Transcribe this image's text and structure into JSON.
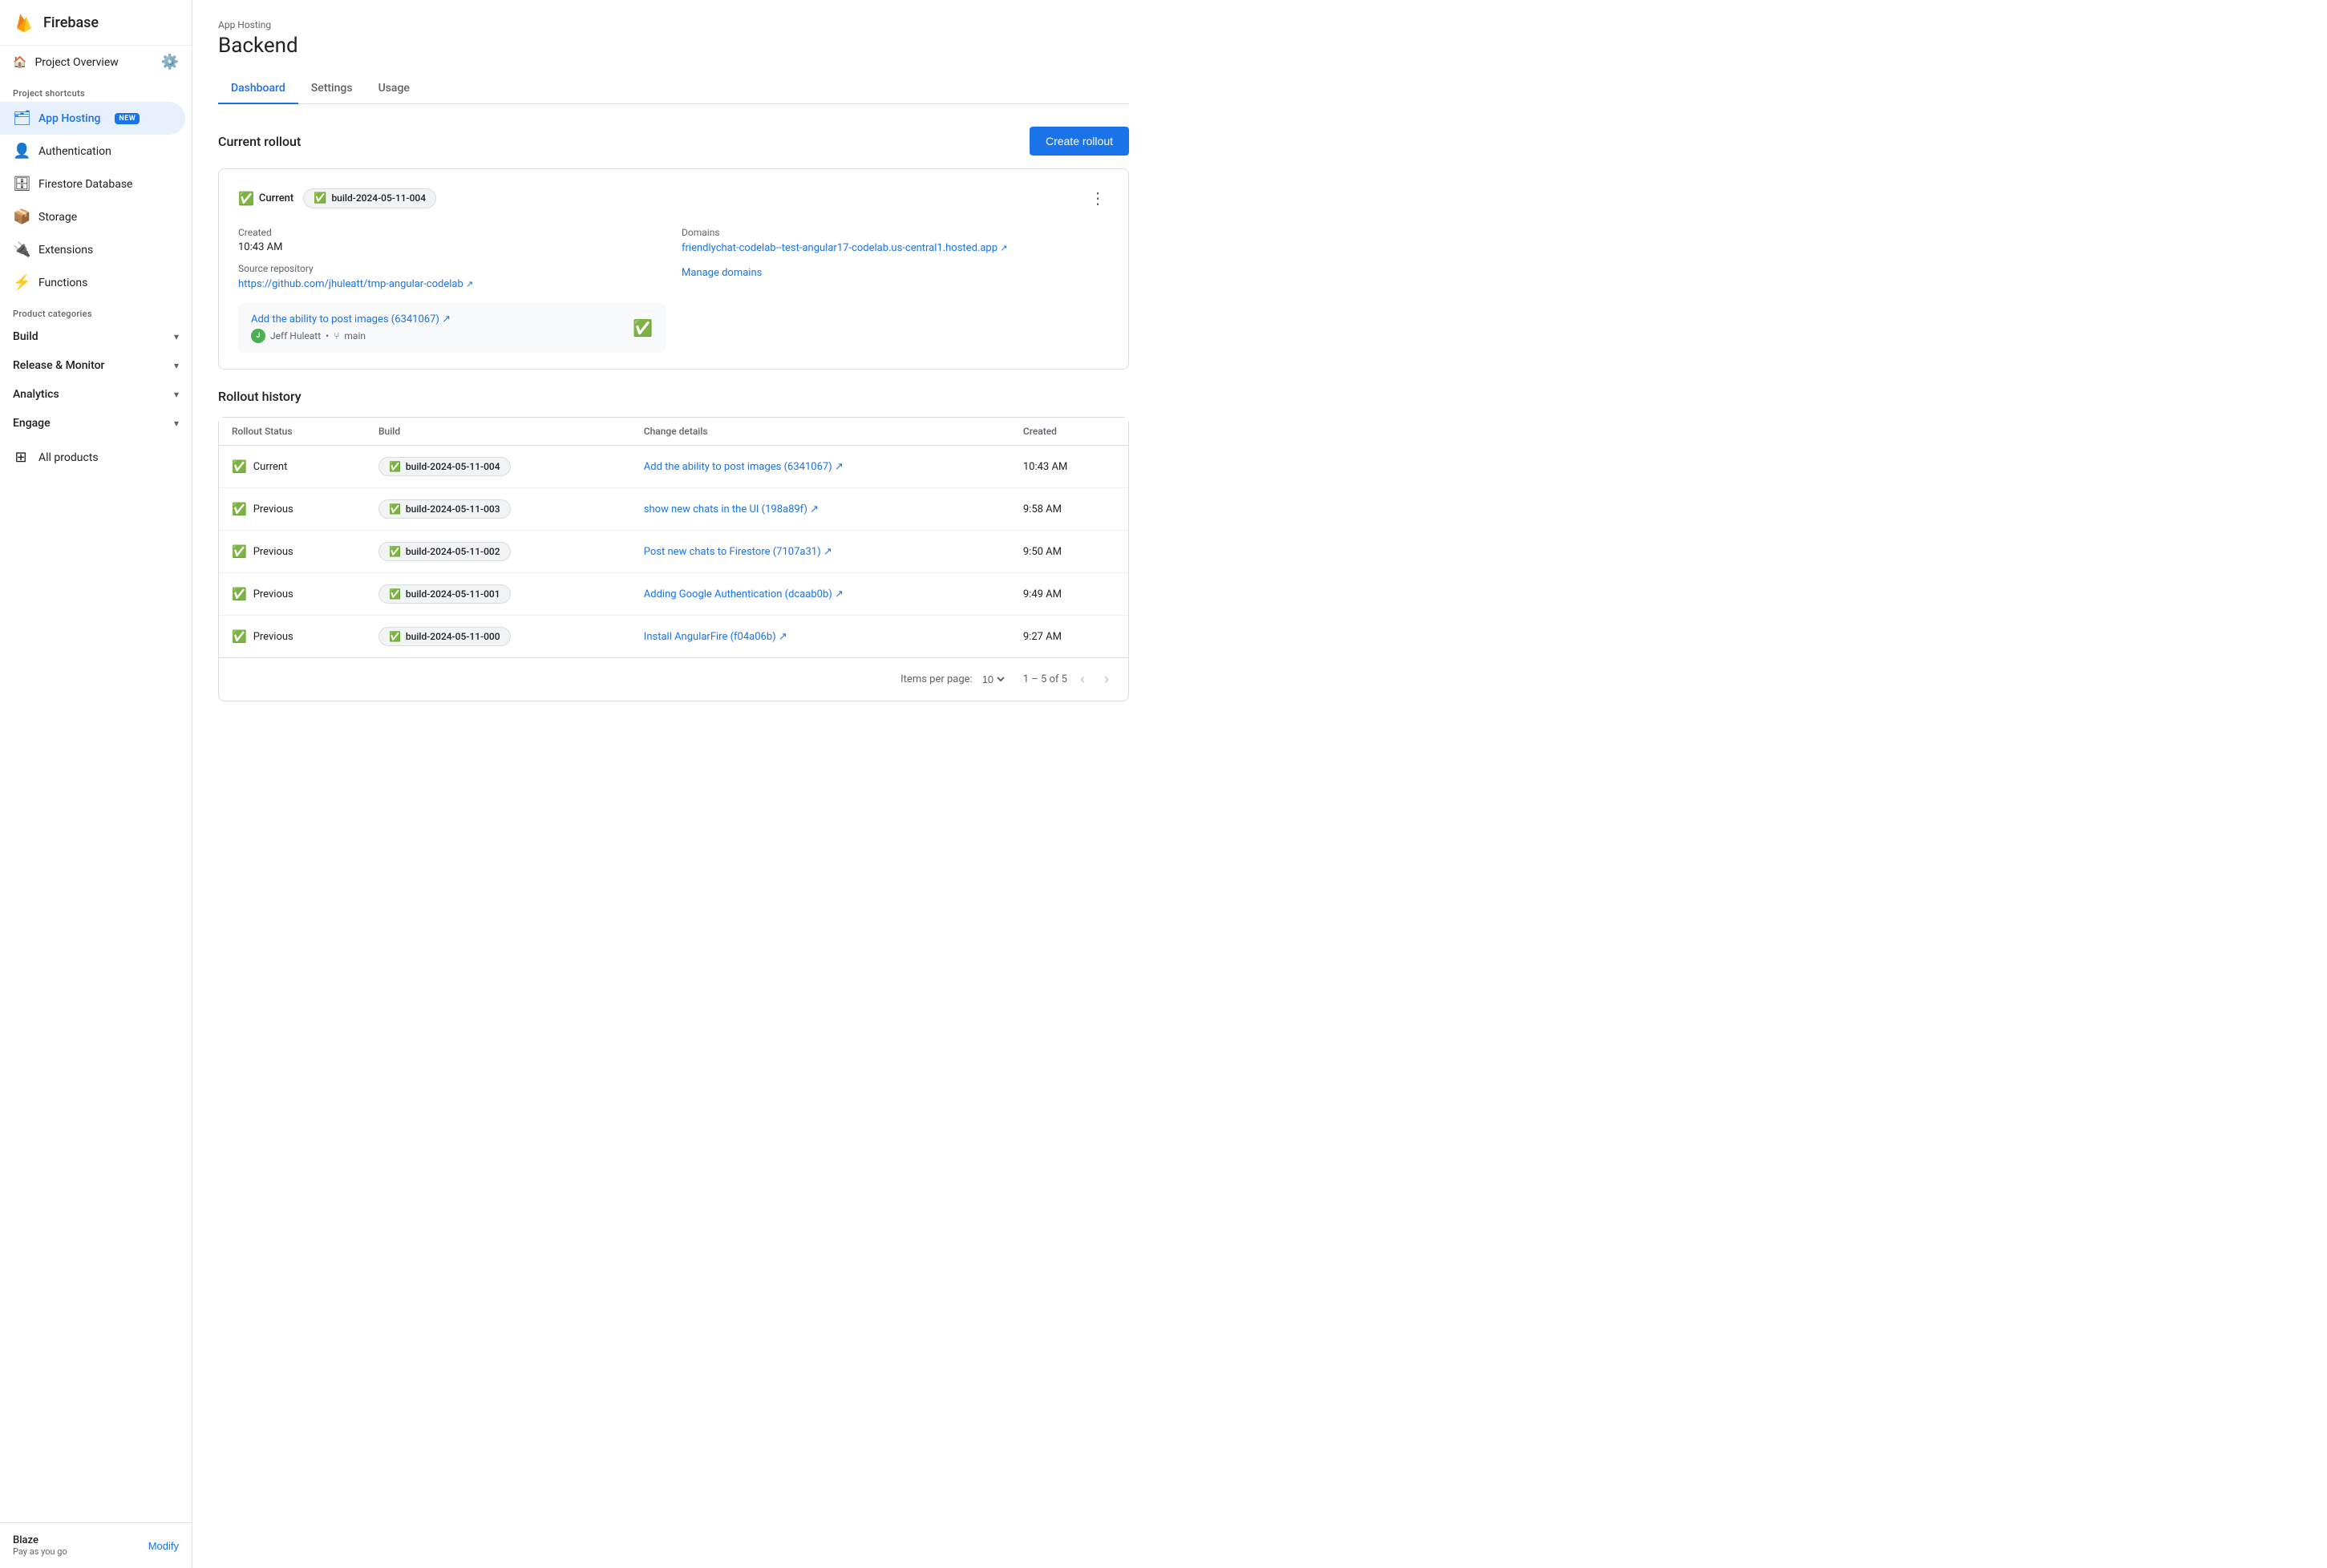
{
  "sidebar": {
    "app_title": "Firebase",
    "project_overview_label": "Project Overview",
    "project_shortcuts_label": "Project shortcuts",
    "nav_items": [
      {
        "id": "app-hosting",
        "label": "App Hosting",
        "icon": "🗂",
        "active": true,
        "badge": "NEW"
      },
      {
        "id": "authentication",
        "label": "Authentication",
        "icon": "👤"
      },
      {
        "id": "firestore",
        "label": "Firestore Database",
        "icon": "🗄"
      },
      {
        "id": "storage",
        "label": "Storage",
        "icon": "📦"
      },
      {
        "id": "extensions",
        "label": "Extensions",
        "icon": "🔌"
      },
      {
        "id": "functions",
        "label": "Functions",
        "icon": "⚡"
      }
    ],
    "product_categories_label": "Product categories",
    "categories": [
      {
        "id": "build",
        "label": "Build"
      },
      {
        "id": "release-monitor",
        "label": "Release & Monitor"
      },
      {
        "id": "analytics",
        "label": "Analytics"
      },
      {
        "id": "engage",
        "label": "Engage"
      }
    ],
    "all_products_label": "All products",
    "footer": {
      "plan_name": "Blaze",
      "plan_sub": "Pay as you go",
      "modify_label": "Modify"
    }
  },
  "header": {
    "breadcrumb": "App Hosting",
    "page_title": "Backend"
  },
  "tabs": [
    {
      "id": "dashboard",
      "label": "Dashboard",
      "active": true
    },
    {
      "id": "settings",
      "label": "Settings"
    },
    {
      "id": "usage",
      "label": "Usage"
    }
  ],
  "current_rollout": {
    "section_title": "Current rollout",
    "create_button_label": "Create rollout",
    "status_label": "Current",
    "build_badge": "build-2024-05-11-004",
    "created_label": "Created",
    "created_value": "10:43 AM",
    "source_repo_label": "Source repository",
    "source_repo_url": "https://github.com/jhuleatt/tmp-angular-codelab",
    "source_repo_display": "https://github.com/jhuleatt/tmp-angular-codelab ↗",
    "domains_label": "Domains",
    "domain_url": "friendlychat-codelab--test-angular17-codelab.us-central1.hosted.app",
    "domain_display": "friendlychat-codelab--test-angular17-codelab.us-central1.hosted.app ↗",
    "commit_link_text": "Add the ability to post images (6341067) ↗",
    "commit_author": "Jeff Huleatt",
    "commit_branch": "main",
    "manage_domains_label": "Manage domains"
  },
  "rollout_history": {
    "section_title": "Rollout history",
    "columns": [
      "Rollout Status",
      "Build",
      "Change details",
      "Created"
    ],
    "rows": [
      {
        "status": "Current",
        "build": "build-2024-05-11-004",
        "change": "Add the ability to post images (6341067) ↗",
        "created": "10:43 AM"
      },
      {
        "status": "Previous",
        "build": "build-2024-05-11-003",
        "change": "show new chats in the UI (198a89f) ↗",
        "created": "9:58 AM"
      },
      {
        "status": "Previous",
        "build": "build-2024-05-11-002",
        "change": "Post new chats to Firestore (7107a31) ↗",
        "created": "9:50 AM"
      },
      {
        "status": "Previous",
        "build": "build-2024-05-11-001",
        "change": "Adding Google Authentication (dcaab0b) ↗",
        "created": "9:49 AM"
      },
      {
        "status": "Previous",
        "build": "build-2024-05-11-000",
        "change": "Install AngularFire (f04a06b) ↗",
        "created": "9:27 AM"
      }
    ],
    "items_per_page_label": "Items per page:",
    "items_per_page_value": "10",
    "pagination_info": "1 – 5 of 5"
  }
}
